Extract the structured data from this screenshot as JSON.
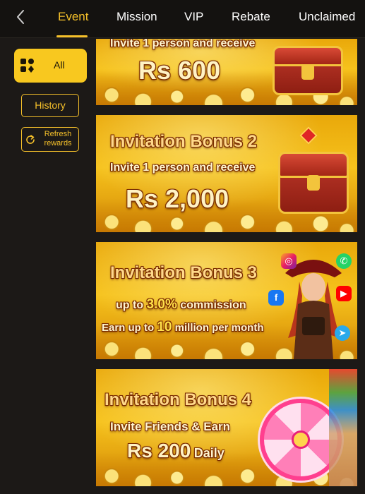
{
  "header": {
    "back_icon": "chevron-left-icon",
    "tabs": [
      {
        "label": "Event",
        "active": true
      },
      {
        "label": "Mission",
        "active": false
      },
      {
        "label": "VIP",
        "active": false
      },
      {
        "label": "Rebate",
        "active": false
      },
      {
        "label": "Unclaimed",
        "active": false
      }
    ]
  },
  "sidebar": {
    "all": {
      "label": "All",
      "icon": "category-grid-icon"
    },
    "history": {
      "label": "History"
    },
    "refresh": {
      "label": "Refresh rewards",
      "icon": "refresh-icon"
    }
  },
  "banners": [
    {
      "subtitle": "Invite 1 person and receive",
      "amount": "Rs 600"
    },
    {
      "title": "Invitation Bonus 2",
      "subtitle": "Invite 1 person and receive",
      "amount": "Rs 2,000"
    },
    {
      "title": "Invitation Bonus 3",
      "line1_prefix": "up to",
      "line1_value": "3.0%",
      "line1_suffix": "commission",
      "line2_prefix": "Earn up to",
      "line2_value": "10",
      "line2_suffix": "million per month",
      "social_icons": [
        "instagram-icon",
        "whatsapp-icon",
        "facebook-icon",
        "youtube-icon",
        "telegram-icon"
      ]
    },
    {
      "title": "Invitation Bonus 4",
      "subtitle": "Invite Friends & Earn",
      "amount": "Rs 200",
      "amount_suffix": "Daily"
    }
  ],
  "colors": {
    "accent": "#f5c02a",
    "background": "#1c1917",
    "topbar": "#141210"
  }
}
